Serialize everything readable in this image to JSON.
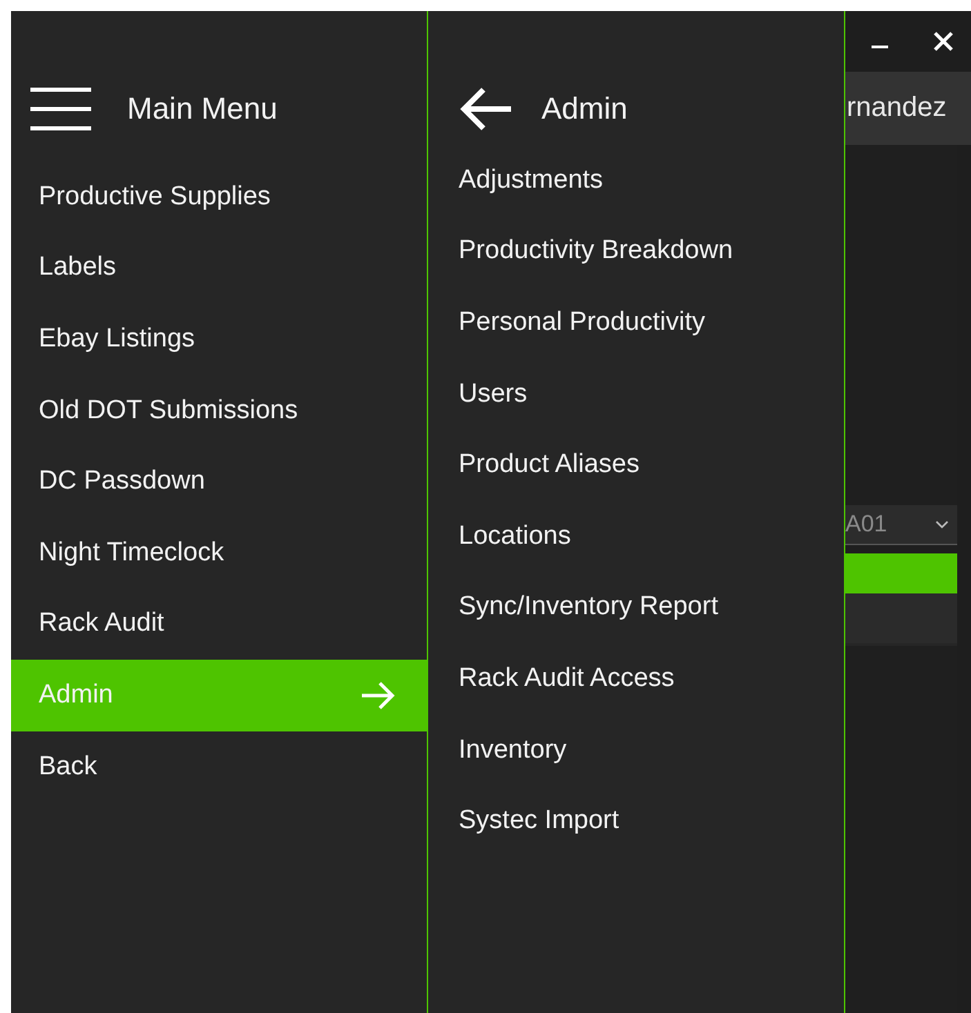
{
  "main_menu": {
    "title": "Main Menu",
    "items": [
      {
        "label": "Productive Supplies",
        "selected": false
      },
      {
        "label": "Labels",
        "selected": false
      },
      {
        "label": "Ebay Listings",
        "selected": false
      },
      {
        "label": "Old DOT Submissions",
        "selected": false
      },
      {
        "label": "DC Passdown",
        "selected": false
      },
      {
        "label": "Night Timeclock",
        "selected": false
      },
      {
        "label": "Rack Audit",
        "selected": false
      },
      {
        "label": "Admin",
        "selected": true
      },
      {
        "label": "Back",
        "selected": false
      }
    ]
  },
  "admin_menu": {
    "title": "Admin",
    "items": [
      "Adjustments",
      "Productivity Breakdown",
      "Personal Productivity",
      "Users",
      "Product Aliases",
      "Locations",
      "Sync/Inventory Report",
      "Rack Audit Access",
      "Inventory",
      "Systec Import"
    ]
  },
  "background": {
    "user_name": "rnandez",
    "dc_select": {
      "value": "A01"
    }
  }
}
